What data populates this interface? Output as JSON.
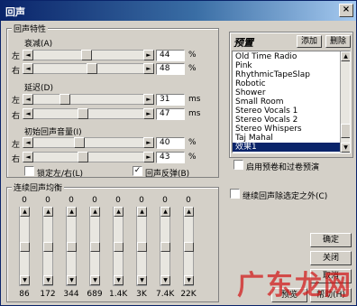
{
  "window": {
    "title": "回声",
    "close_icon": "×"
  },
  "echo": {
    "group_label": "回声特性",
    "decay": {
      "label": "衰减(A)",
      "left_label": "左",
      "right_label": "右",
      "left_value": "44",
      "right_value": "48",
      "unit": "%",
      "left_level_pct": 44,
      "right_level_pct": 48
    },
    "delay": {
      "label": "延迟(D)",
      "left_label": "左",
      "right_label": "右",
      "left_value": "31",
      "right_value": "47",
      "unit": "ms",
      "left_level_pct": 31,
      "right_level_pct": 47
    },
    "initial": {
      "label": "初始回声音量(I)",
      "left_label": "左",
      "right_label": "右",
      "left_value": "40",
      "right_value": "43",
      "unit": "%",
      "left_level_pct": 40,
      "right_level_pct": 43
    },
    "lock_label": "锁定左/右(L)",
    "feedback_label": "回声反弹(B)",
    "feedback_checked": true,
    "lock_checked": false
  },
  "presets": {
    "title": "预置",
    "add_label": "添加",
    "delete_label": "删除",
    "items": [
      "Old Time Radio",
      "Pink",
      "RhythmicTapeSlap",
      "Robotic",
      "Shower",
      "Small Room",
      "Stereo Vocals 1",
      "Stereo Vocals 2",
      "Stereo Whispers",
      "Taj Mahal",
      "效果1"
    ],
    "selected_index": 10,
    "enable_preview_label": "启用预卷和过卷预演"
  },
  "continue_label": "继续回声除选定之外(C)",
  "eq": {
    "group_label": "连续回声均衡",
    "bands": [
      {
        "top": "0",
        "freq": "86"
      },
      {
        "top": "0",
        "freq": "172"
      },
      {
        "top": "0",
        "freq": "344"
      },
      {
        "top": "0",
        "freq": "689"
      },
      {
        "top": "0",
        "freq": "1.4K"
      },
      {
        "top": "0",
        "freq": "3K"
      },
      {
        "top": "0",
        "freq": "7.4K"
      },
      {
        "top": "0",
        "freq": "22K"
      }
    ]
  },
  "buttons": {
    "ok": "确定",
    "close": "关闭",
    "cancel": "取消",
    "preview": "预览",
    "help": "帮助(H)"
  },
  "watermark": "广东龙网"
}
